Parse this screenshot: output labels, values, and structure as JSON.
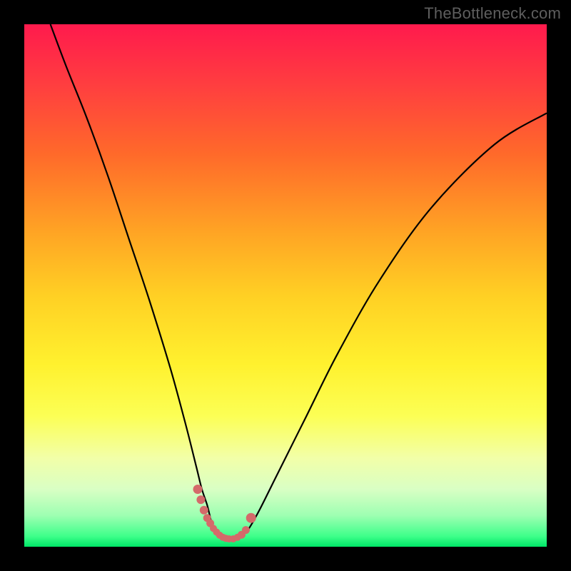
{
  "watermark": "TheBottleneck.com",
  "colors": {
    "frame_bg": "#000000",
    "curve": "#000000",
    "marker": "#d46a6a"
  },
  "chart_data": {
    "type": "line",
    "title": "",
    "xlabel": "",
    "ylabel": "",
    "xlim": [
      0,
      100
    ],
    "ylim": [
      0,
      100
    ],
    "grid": false,
    "series": [
      {
        "name": "bottleneck-curve",
        "x": [
          5,
          8,
          12,
          16,
          20,
          24,
          28,
          31,
          33,
          34,
          35,
          35.5,
          36,
          36.5,
          37,
          38,
          39,
          40,
          41,
          42,
          43,
          45,
          48,
          54,
          60,
          68,
          78,
          90,
          100
        ],
        "y": [
          100,
          92,
          82,
          71,
          59,
          47,
          34,
          23,
          15,
          11,
          8,
          6,
          4,
          3,
          2,
          1.5,
          1.2,
          1.2,
          1.5,
          2.5,
          3.5,
          7,
          13,
          25,
          37,
          51,
          65,
          77,
          83
        ]
      }
    ],
    "markers": {
      "name": "highlight-dots",
      "x": [
        33.2,
        33.8,
        34.4,
        35.0,
        35.6,
        36.2,
        36.8,
        37.4,
        38.0,
        38.6,
        39.2,
        40.0,
        40.8,
        41.6,
        42.4,
        43.4
      ],
      "y": [
        11,
        9,
        7,
        5.5,
        4.5,
        3.5,
        2.8,
        2.2,
        1.8,
        1.6,
        1.5,
        1.5,
        1.8,
        2.3,
        3.2,
        5.5
      ],
      "r": [
        6.5,
        6,
        6,
        5.5,
        5.5,
        5,
        5,
        5,
        5,
        5,
        5,
        5,
        5,
        5.5,
        5.5,
        7
      ]
    }
  }
}
